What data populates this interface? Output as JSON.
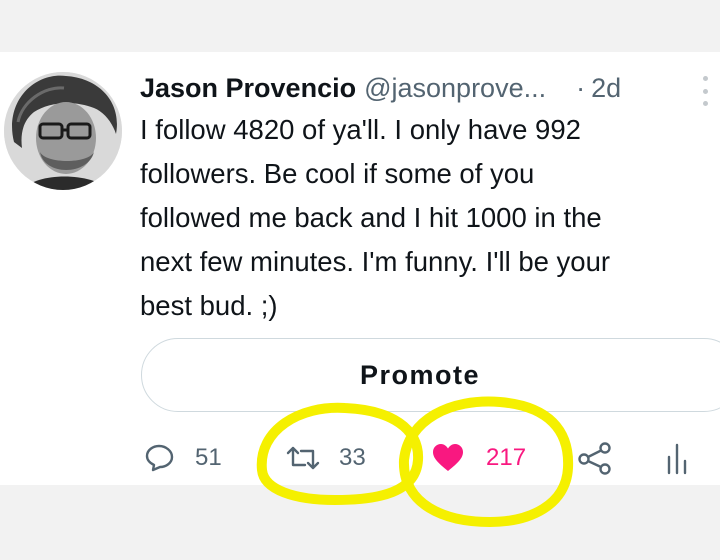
{
  "tweet": {
    "author_name": "Jason Provencio",
    "handle": "@jasonprove...",
    "separator": "·",
    "time": "2d",
    "text_lines": [
      "I follow 4820 of ya'll. I only have 992",
      "followers. Be cool if some of you",
      "followed me back and I hit 1000 in the",
      "next few minutes. I'm funny. I'll be your",
      "best bud. ;)"
    ]
  },
  "promote_button": {
    "label": "Promote"
  },
  "actions": {
    "reply": {
      "icon": "reply-bubble-icon",
      "count": "51"
    },
    "retweet": {
      "icon": "retweet-icon",
      "count": "33"
    },
    "like": {
      "icon": "heart-icon",
      "count": "217",
      "liked": true
    },
    "share": {
      "icon": "share-icon"
    },
    "analytics": {
      "icon": "analytics-icon"
    }
  },
  "colors": {
    "text": "#0f1419",
    "secondary": "#536471",
    "like": "#f91880",
    "highlight": "#f5f000",
    "border": "#cfd9de"
  }
}
